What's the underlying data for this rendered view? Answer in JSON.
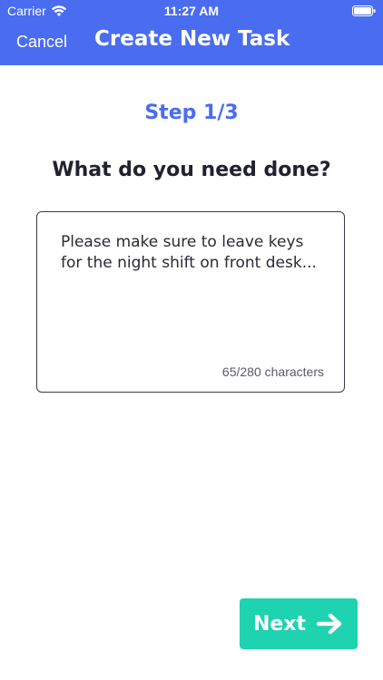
{
  "status_bar": {
    "carrier": "Carrier",
    "time": "11:27 AM"
  },
  "nav": {
    "cancel_label": "Cancel",
    "title": "Create New Task"
  },
  "step": {
    "label": "Step 1/3"
  },
  "question": "What do you need done?",
  "task": {
    "text": "Please make sure to leave keys for the night shift on front desk...",
    "char_count": "65/280 characters"
  },
  "next_button": {
    "label": "Next"
  },
  "colors": {
    "header_bg": "#4a6cf0",
    "accent": "#4a6cf0",
    "next_bg": "#1dd3b0"
  }
}
